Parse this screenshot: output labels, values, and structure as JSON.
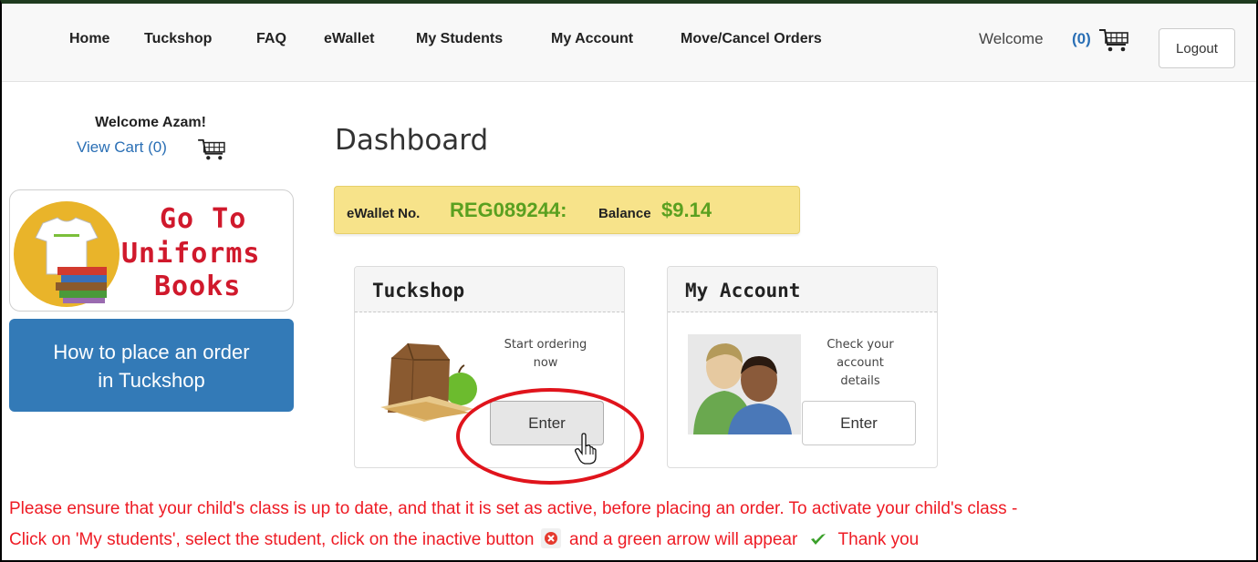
{
  "nav": {
    "items": [
      "Home",
      "Tuckshop",
      "FAQ",
      "eWallet",
      "My Students",
      "My Account",
      "Move/Cancel Orders"
    ],
    "welcome": "Welcome",
    "cart_count": "(0)",
    "logout_label": "Logout"
  },
  "sidebar": {
    "welcome": "Welcome Azam!",
    "view_cart": "View Cart (0)",
    "banner": {
      "line1": "Go To",
      "line2": "Uniforms",
      "line3": "Books"
    },
    "howto_line1": "How to place an order",
    "howto_line2": "in Tuckshop"
  },
  "main": {
    "title": "Dashboard",
    "wallet": {
      "label": "eWallet No.",
      "number": "REG089244:",
      "balance_label": "Balance",
      "balance": "$9.14"
    },
    "panels": [
      {
        "title": "Tuckshop",
        "desc": [
          "Start ordering",
          "now"
        ],
        "button": "Enter"
      },
      {
        "title": "My Account",
        "desc": [
          "Check your",
          "account",
          "details"
        ],
        "button": "Enter"
      }
    ]
  },
  "notice": {
    "line1": "Please ensure that your child's class is up to date, and that it is set as active, before placing an order. To activate your child's class -",
    "line2_a": "Click on 'My students', select the student, click on the inactive button",
    "line2_b": "and a green arrow will appear",
    "line2_c": "Thank you"
  },
  "colors": {
    "link_blue": "#2a6fb5",
    "primary_button": "#337ab7",
    "wallet_green": "#5aa020",
    "wallet_bg": "#f7e38a",
    "notice_red": "#ee1b24",
    "annotation_red": "#e0141c"
  }
}
